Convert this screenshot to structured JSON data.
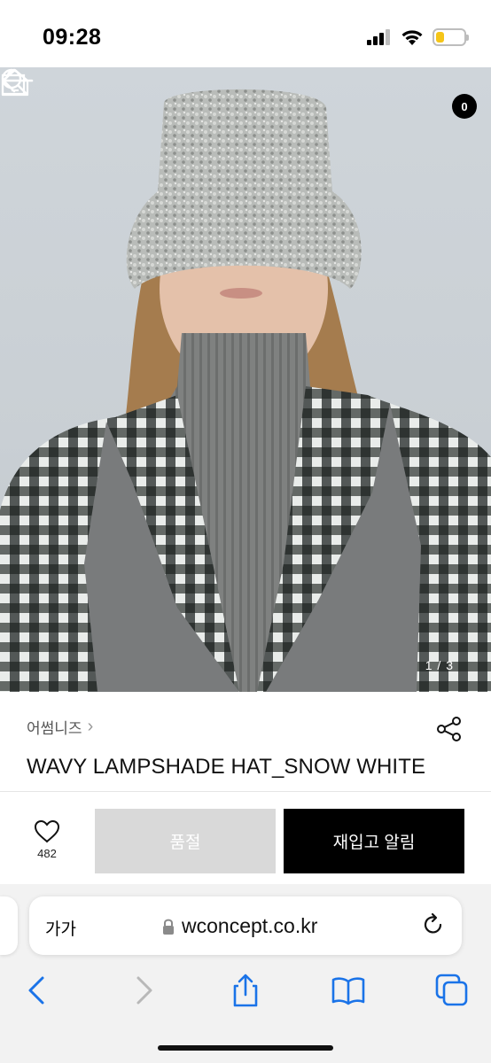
{
  "status_bar": {
    "time": "09:28",
    "battery_level": 0.25
  },
  "header": {
    "cart_count": "0"
  },
  "gallery": {
    "counter": "1 / 3"
  },
  "product": {
    "brand": "어썸니즈",
    "brand_chevron": "›",
    "title": "WAVY LAMPSHADE HAT_SNOW WHITE",
    "like_count": "482"
  },
  "actions": {
    "sold_out_label": "품절",
    "restock_label": "재입고 알림"
  },
  "browser": {
    "text_size_label": "가가",
    "url": "wconcept.co.kr"
  },
  "colors": {
    "accent_black": "#000000",
    "sold_out_gray": "#d9d9d9",
    "safari_blue": "#1a73e8",
    "battery_yellow": "#f5c518"
  }
}
